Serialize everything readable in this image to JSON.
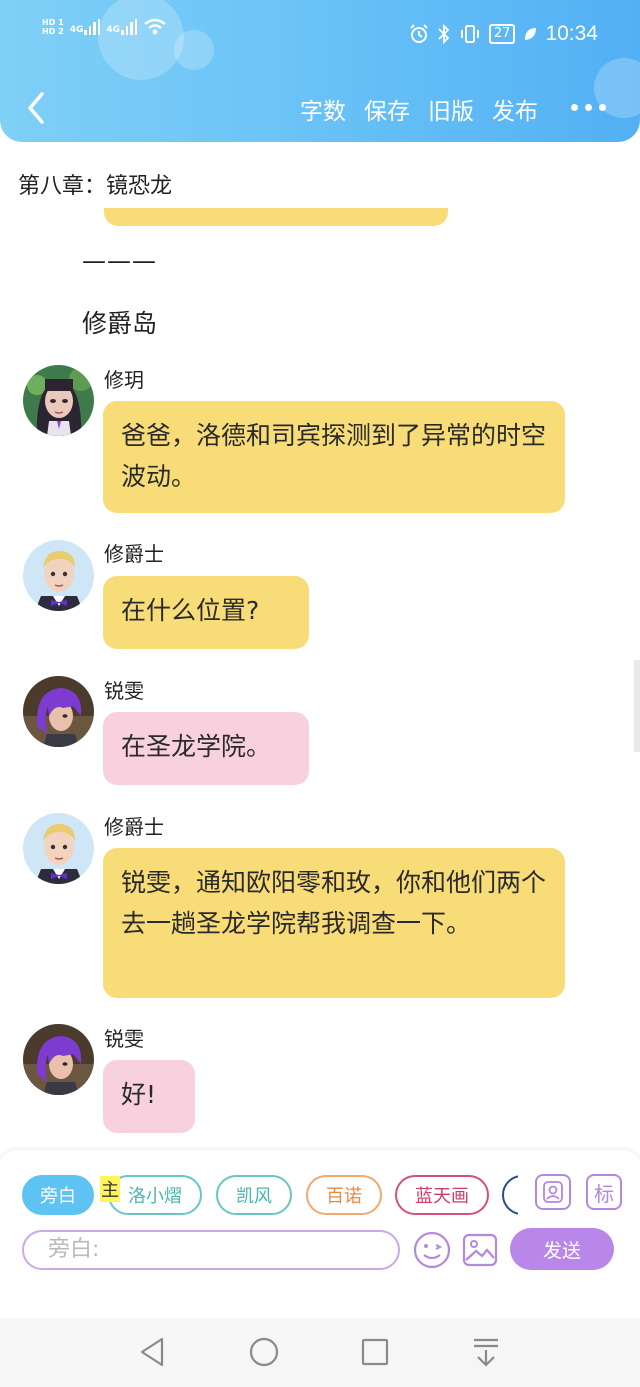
{
  "status_bar": {
    "sim1": "HD 1",
    "sim2": "HD 2",
    "net1": "4G",
    "net2": "4G",
    "battery": "27",
    "time": "10:34"
  },
  "toolbar": {
    "word_count": "字数",
    "save": "保存",
    "old_version": "旧版",
    "publish": "发布"
  },
  "chapter_title": "第八章：镜恐龙",
  "divider_text": "———",
  "location_text": "修爵岛",
  "messages": [
    {
      "speaker": "修玥",
      "text": "爸爸，洛德和司宾探测到了异常的时空波动。"
    },
    {
      "speaker": "修爵士",
      "text": "在什么位置?"
    },
    {
      "speaker": "锐雯",
      "text": "在圣龙学院。"
    },
    {
      "speaker": "修爵士",
      "text": "锐雯，通知欧阳零和玫，你和他们两个去一趟圣龙学院帮我调查一下。"
    },
    {
      "speaker": "锐雯",
      "text": "好!"
    }
  ],
  "characters": {
    "narration": "旁白",
    "main_tag": "主",
    "c1": "洛小熠",
    "c2": "凯风",
    "c3": "百诺",
    "c4": "蓝天画"
  },
  "tag_button": "标",
  "input": {
    "placeholder": "旁白:"
  },
  "send_button": "发送",
  "colors": {
    "header_start": "#7fd0f6",
    "header_end": "#52b0f4",
    "bubble_yellow": "#f8dc78",
    "bubble_pink": "#f9d1de",
    "accent_purple": "#b987ea",
    "chip_active": "#5ec3f2"
  }
}
